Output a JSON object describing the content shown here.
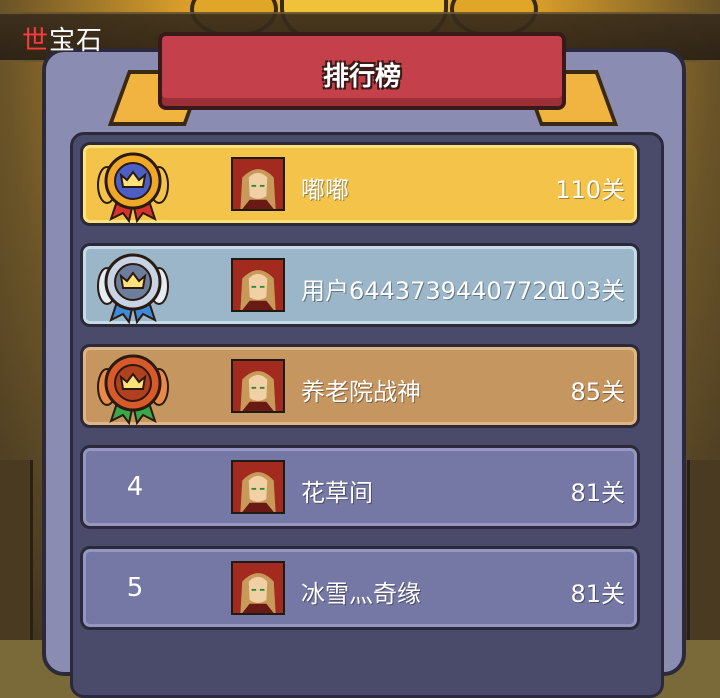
{
  "header": {
    "title_highlight": "世",
    "title_rest": "宝石"
  },
  "panel": {
    "title": "排行榜"
  },
  "ranking": [
    {
      "rank": "1",
      "tier": "gold",
      "medal": "gold-crown-medal-icon",
      "name": "嘟嘟",
      "level": "110关"
    },
    {
      "rank": "2",
      "tier": "silver",
      "medal": "silver-crown-medal-icon",
      "name": "用户64437394407720",
      "level": "103关"
    },
    {
      "rank": "3",
      "tier": "bronze",
      "medal": "bronze-crown-medal-icon",
      "name": "养老院战神",
      "level": "85关"
    },
    {
      "rank": "4",
      "tier": "plain",
      "medal": "",
      "name": "花草间",
      "level": "81关"
    },
    {
      "rank": "5",
      "tier": "plain",
      "medal": "",
      "name": "冰雪灬奇缘",
      "level": "81关"
    }
  ],
  "colors": {
    "gold_row": "#f4c44a",
    "silver_row": "#9ab6c8",
    "bronze_row": "#c69660",
    "plain_row": "#7577a4",
    "ribbon": "#c4404a",
    "title_highlight": "#ff3b3b"
  }
}
